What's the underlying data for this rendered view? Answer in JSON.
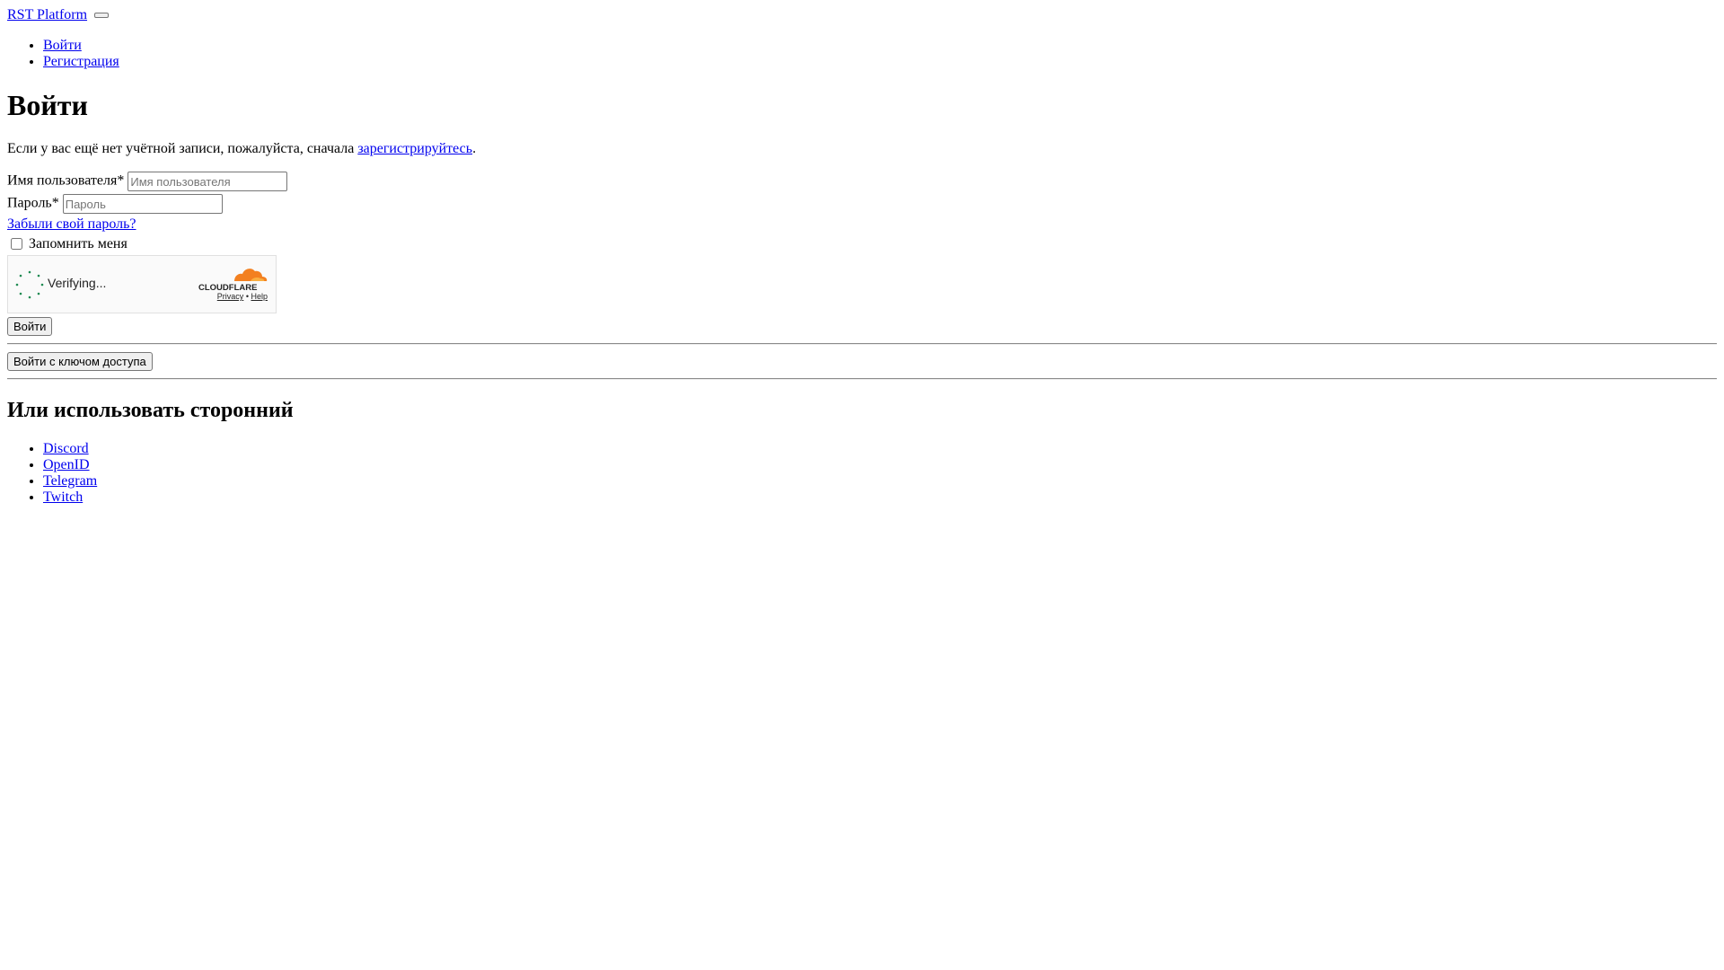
{
  "header": {
    "brand": "RST Platform"
  },
  "nav": {
    "items": [
      {
        "label": "Войти"
      },
      {
        "label": "Регистрация"
      }
    ]
  },
  "main": {
    "title": "Войти",
    "intro_prefix": "Если у вас ещё нет учётной записи, пожалуйста, сначала ",
    "intro_link": "зарегистрируйтесь",
    "intro_suffix": "."
  },
  "form": {
    "username": {
      "label": "Имя пользователя*",
      "placeholder": "Имя пользователя",
      "value": ""
    },
    "password": {
      "label": "Пароль*",
      "placeholder": "Пароль",
      "value": ""
    },
    "forgot_label": "Забыли свой пароль?",
    "remember_label": "Запомнить меня",
    "remember_checked": false,
    "submit_label": "Войти",
    "passkey_label": "Войти с ключом доступа"
  },
  "captcha": {
    "status": "Verifying...",
    "brand": "CLOUDFLARE",
    "privacy_label": "Privacy",
    "separator": "•",
    "help_label": "Help"
  },
  "third_party": {
    "title": "Или использовать сторонний",
    "providers": [
      {
        "label": "Discord"
      },
      {
        "label": "OpenID"
      },
      {
        "label": "Telegram"
      },
      {
        "label": "Twitch"
      }
    ]
  },
  "colors": {
    "link": "#0000ee",
    "cloudflare_orange": "#f38020",
    "spinner_green": "#1e8a52"
  }
}
